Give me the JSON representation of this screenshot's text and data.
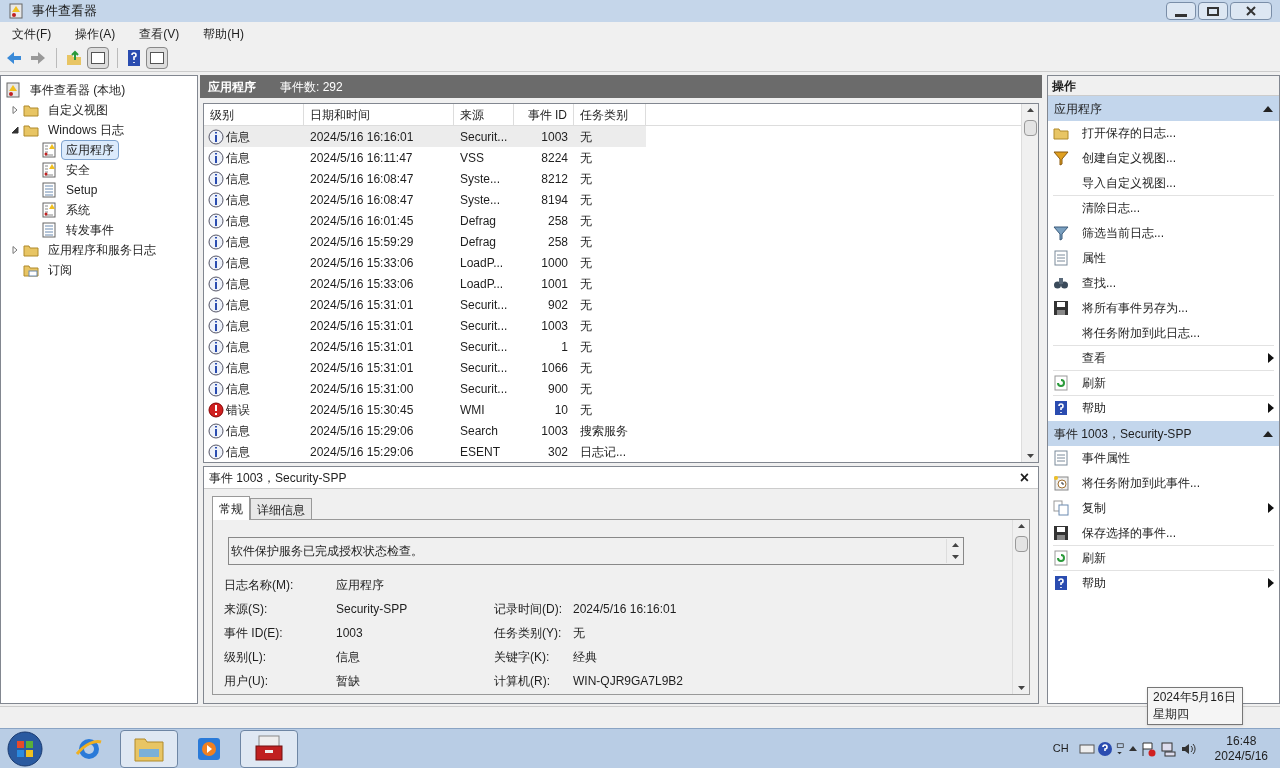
{
  "window": {
    "title": "事件查看器"
  },
  "menu": [
    "文件(F)",
    "操作(A)",
    "查看(V)",
    "帮助(H)"
  ],
  "tree": [
    {
      "label": "事件查看器 (本地)",
      "selected": false,
      "children": [
        {
          "label": "自定义视图",
          "selected": false,
          "expanded": false
        },
        {
          "label": "Windows 日志",
          "selected": false,
          "expanded": true,
          "children": [
            {
              "label": "应用程序",
              "selected": true,
              "kind": "warnlog"
            },
            {
              "label": "安全",
              "selected": false,
              "kind": "warnlog"
            },
            {
              "label": "Setup",
              "selected": false,
              "kind": "log"
            },
            {
              "label": "系统",
              "selected": false,
              "kind": "warnlog"
            },
            {
              "label": "转发事件",
              "selected": false,
              "kind": "log"
            }
          ]
        },
        {
          "label": "应用程序和服务日志",
          "selected": false,
          "expanded": false
        },
        {
          "label": "订阅",
          "selected": false,
          "kind": "leaf"
        }
      ]
    }
  ],
  "list_header": {
    "title": "应用程序",
    "count": "事件数: 292"
  },
  "table": {
    "columns": [
      "级别",
      "日期和时间",
      "来源",
      "事件 ID",
      "任务类别"
    ],
    "rows": [
      {
        "kind": "info",
        "level": "信息",
        "time": "2024/5/16 16:16:01",
        "source": "Securit...",
        "id": "1003",
        "category": "无",
        "selected": true
      },
      {
        "kind": "info",
        "level": "信息",
        "time": "2024/5/16 16:11:47",
        "source": "VSS",
        "id": "8224",
        "category": "无",
        "selected": false
      },
      {
        "kind": "info",
        "level": "信息",
        "time": "2024/5/16 16:08:47",
        "source": "Syste...",
        "id": "8212",
        "category": "无",
        "selected": false
      },
      {
        "kind": "info",
        "level": "信息",
        "time": "2024/5/16 16:08:47",
        "source": "Syste...",
        "id": "8194",
        "category": "无",
        "selected": false
      },
      {
        "kind": "info",
        "level": "信息",
        "time": "2024/5/16 16:01:45",
        "source": "Defrag",
        "id": "258",
        "category": "无",
        "selected": false
      },
      {
        "kind": "info",
        "level": "信息",
        "time": "2024/5/16 15:59:29",
        "source": "Defrag",
        "id": "258",
        "category": "无",
        "selected": false
      },
      {
        "kind": "info",
        "level": "信息",
        "time": "2024/5/16 15:33:06",
        "source": "LoadP...",
        "id": "1000",
        "category": "无",
        "selected": false
      },
      {
        "kind": "info",
        "level": "信息",
        "time": "2024/5/16 15:33:06",
        "source": "LoadP...",
        "id": "1001",
        "category": "无",
        "selected": false
      },
      {
        "kind": "info",
        "level": "信息",
        "time": "2024/5/16 15:31:01",
        "source": "Securit...",
        "id": "902",
        "category": "无",
        "selected": false
      },
      {
        "kind": "info",
        "level": "信息",
        "time": "2024/5/16 15:31:01",
        "source": "Securit...",
        "id": "1003",
        "category": "无",
        "selected": false
      },
      {
        "kind": "info",
        "level": "信息",
        "time": "2024/5/16 15:31:01",
        "source": "Securit...",
        "id": "1",
        "category": "无",
        "selected": false
      },
      {
        "kind": "info",
        "level": "信息",
        "time": "2024/5/16 15:31:01",
        "source": "Securit...",
        "id": "1066",
        "category": "无",
        "selected": false
      },
      {
        "kind": "info",
        "level": "信息",
        "time": "2024/5/16 15:31:00",
        "source": "Securit...",
        "id": "900",
        "category": "无",
        "selected": false
      },
      {
        "kind": "error",
        "level": "错误",
        "time": "2024/5/16 15:30:45",
        "source": "WMI",
        "id": "10",
        "category": "无",
        "selected": false
      },
      {
        "kind": "info",
        "level": "信息",
        "time": "2024/5/16 15:29:06",
        "source": "Search",
        "id": "1003",
        "category": "搜索服务",
        "selected": false
      },
      {
        "kind": "info",
        "level": "信息",
        "time": "2024/5/16 15:29:06",
        "source": "ESENT",
        "id": "302",
        "category": "日志记...",
        "selected": false
      }
    ]
  },
  "detail": {
    "title": "事件 1003，Security-SPP",
    "close": "×",
    "tabs": [
      {
        "label": "常规",
        "selected": true
      },
      {
        "label": "详细信息",
        "selected": false
      }
    ],
    "message": "软件保护服务已完成授权状态检查。",
    "fields": [
      {
        "label": "日志名称(M):",
        "value": "应用程序"
      },
      {
        "label": "来源(S):",
        "value": "Security-SPP",
        "label2": "记录时间(D):",
        "value2": "2024/5/16 16:16:01"
      },
      {
        "label": "事件 ID(E):",
        "value": "1003",
        "label2": "任务类别(Y):",
        "value2": "无"
      },
      {
        "label": "级别(L):",
        "value": "信息",
        "label2": "关键字(K):",
        "value2": "经典"
      },
      {
        "label": "用户(U):",
        "value": "暂缺",
        "label2": "计算机(R):",
        "value2": "WIN-QJR9GA7L9B2"
      }
    ]
  },
  "actions": {
    "title": "操作",
    "sections": [
      {
        "title": "应用程序",
        "expanded": true,
        "items": [
          {
            "label": "打开保存的日志...",
            "kind": "folder"
          },
          {
            "label": "创建自定义视图...",
            "kind": "funnel"
          },
          {
            "label": "导入自定义视图...",
            "kind": "none",
            "divider": true
          },
          {
            "label": "清除日志...",
            "kind": "none"
          },
          {
            "label": "筛选当前日志...",
            "kind": "filter"
          },
          {
            "label": "属性",
            "kind": "props"
          },
          {
            "label": "查找...",
            "kind": "find"
          },
          {
            "label": "将所有事件另存为...",
            "kind": "save"
          },
          {
            "label": "将任务附加到此日志...",
            "kind": "none",
            "divider": true
          },
          {
            "label": "查看",
            "kind": "none",
            "submenu": true,
            "divider": true
          },
          {
            "label": "刷新",
            "kind": "refresh",
            "divider": true
          },
          {
            "label": "帮助",
            "kind": "help",
            "submenu": true
          }
        ]
      },
      {
        "title": "事件 1003，Security-SPP",
        "expanded": true,
        "items": [
          {
            "label": "事件属性",
            "kind": "props"
          },
          {
            "label": "将任务附加到此事件...",
            "kind": "task"
          },
          {
            "label": "复制",
            "kind": "copy",
            "submenu": true
          },
          {
            "label": "保存选择的事件...",
            "kind": "save",
            "divider": true
          },
          {
            "label": "刷新",
            "kind": "refresh",
            "divider": true
          },
          {
            "label": "帮助",
            "kind": "help",
            "submenu": true
          }
        ]
      }
    ]
  },
  "tooltip": {
    "date": "2024年5月16日",
    "weekday": "星期四"
  },
  "taskbar": {
    "apps": [
      {
        "kind": "ie",
        "selected": false
      },
      {
        "kind": "explorer",
        "selected": true
      },
      {
        "kind": "media",
        "selected": false
      },
      {
        "kind": "toolbox",
        "selected": true
      }
    ],
    "language": "CH",
    "time": "16:48",
    "date": "2024/5/16"
  }
}
